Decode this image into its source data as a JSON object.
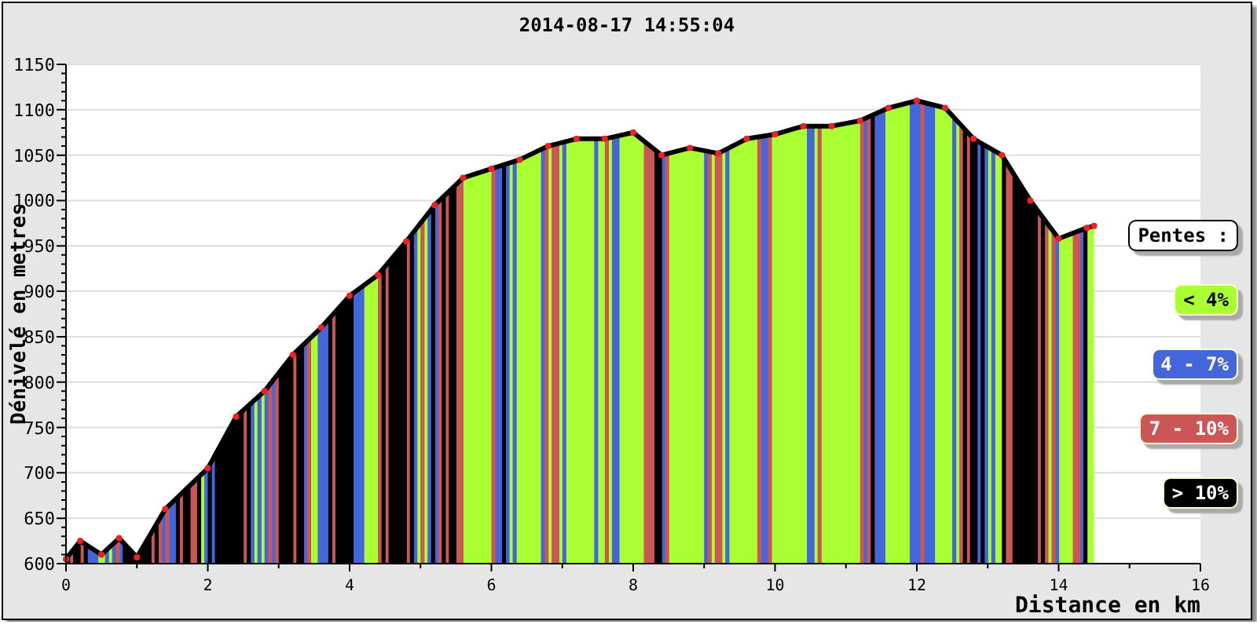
{
  "chart": {
    "chart_data": {
      "type": "area",
      "title": "2014-08-17 14:55:04",
      "xlabel": "Distance en km",
      "ylabel": "Dénivelé en metres",
      "x": [
        0,
        0.2,
        0.5,
        0.75,
        1.0,
        1.4,
        2.0,
        2.4,
        2.8,
        3.2,
        3.6,
        4.0,
        4.4,
        4.8,
        5.2,
        5.6,
        6.0,
        6.4,
        6.8,
        7.2,
        7.6,
        8.0,
        8.4,
        8.8,
        9.2,
        9.6,
        10.0,
        10.4,
        10.8,
        11.2,
        11.6,
        12.0,
        12.4,
        12.8,
        13.2,
        13.6,
        14.0,
        14.4,
        14.5
      ],
      "series": [
        {
          "color": "#000000",
          "values": [
            605,
            625,
            610,
            628,
            607,
            660,
            705,
            762,
            790,
            830,
            860,
            895,
            918,
            955,
            995,
            1025,
            1035,
            1045,
            1060,
            1068,
            1068,
            1075,
            1050,
            1058,
            1052,
            1068,
            1073,
            1082,
            1082,
            1088,
            1102,
            1110,
            1102,
            1068,
            1050,
            1000,
            958,
            970,
            972
          ]
        }
      ],
      "grid": true,
      "xlim": [
        0,
        16
      ],
      "ylim": [
        600,
        1150
      ],
      "xticks": [
        0,
        2,
        4,
        6,
        8,
        10,
        12,
        14,
        16
      ],
      "yticks": [
        600,
        650,
        700,
        750,
        800,
        850,
        900,
        950,
        1000,
        1050,
        1100,
        1150
      ]
    }
  },
  "legend": {
    "title": "Pentes :",
    "items": [
      {
        "label": "< 4%",
        "color": "#aaff33"
      },
      {
        "label": "4 - 7%",
        "color": "#4466dd"
      },
      {
        "label": "7 - 10%",
        "color": "#cc5555"
      },
      {
        "label": "> 10%",
        "color": "#000000"
      }
    ]
  }
}
